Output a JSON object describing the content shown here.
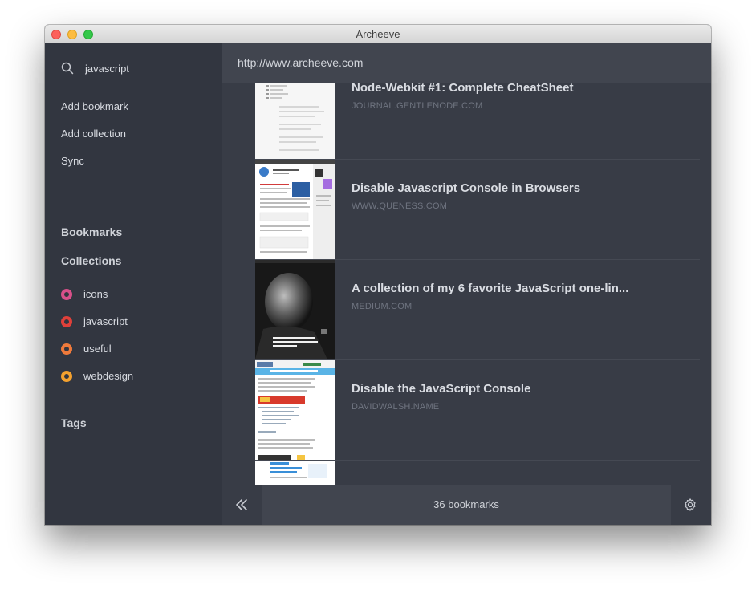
{
  "window": {
    "title": "Archeeve"
  },
  "sidebar": {
    "search": {
      "value": "javascript",
      "icon": "search-icon"
    },
    "actions": [
      {
        "label": "Add bookmark"
      },
      {
        "label": "Add collection"
      },
      {
        "label": "Sync"
      }
    ],
    "bookmarks_heading": "Bookmarks",
    "collections_heading": "Collections",
    "collections": [
      {
        "label": "icons",
        "color": "#d9508a"
      },
      {
        "label": "javascript",
        "color": "#e0403a"
      },
      {
        "label": "useful",
        "color": "#ef7a3b"
      },
      {
        "label": "webdesign",
        "color": "#f4a12e"
      }
    ],
    "tags_heading": "Tags"
  },
  "main": {
    "url": "http://www.archeeve.com",
    "items": [
      {
        "title": "Node-Webkit #1: Complete CheatSheet",
        "domain": "JOURNAL.GENTLENODE.COM"
      },
      {
        "title": "Disable Javascript Console in Browsers",
        "domain": "WWW.QUENESS.COM"
      },
      {
        "title": "A collection of my 6 favorite JavaScript one-lin...",
        "domain": "MEDIUM.COM"
      },
      {
        "title": "Disable the JavaScript Console",
        "domain": "DAVIDWALSH.NAME"
      },
      {
        "title": "",
        "domain": ""
      }
    ],
    "footer": {
      "count": "36 bookmarks"
    }
  }
}
